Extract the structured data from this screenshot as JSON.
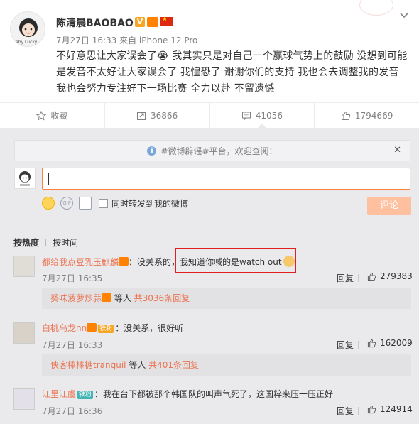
{
  "post": {
    "author": "陈清晨BAOBAO",
    "meta": "7月27日 16:33 来自 iPhone 12 Pro",
    "text": "不好意思让大家误会了😭 我其实只是对自己一个赢球气势上的鼓励 没想到可能是发音不太好让大家误会了 我惶恐了 谢谢你们的支持 我也会去调整我的发音 我也会努力专注好下一场比赛 全力以赴 不留遗憾",
    "avatar_caption": "Baby Lucky"
  },
  "actions": {
    "favorite": "收藏",
    "repost": "36866",
    "comment": "41056",
    "like": "1794669"
  },
  "notice": {
    "text": "#微博辟谣#平台，欢迎查阅！"
  },
  "composer": {
    "repost_checkbox_label": "同时转发到我的微博",
    "submit_label": "评论",
    "gif_label": "GIF"
  },
  "sort": {
    "hot": "按热度",
    "time": "按时间"
  },
  "comments": [
    {
      "name": "都给我点豆乳玉麒麟",
      "text_before": "：没关系的，",
      "text_highlight": "我知道你喊的是watch out",
      "time": "7月27日 16:35",
      "reply": "回复",
      "likes": "279383",
      "sub_name": "葵味菠萝炒蒜",
      "sub_mid": " 等人 ",
      "sub_count": "共3036条回复"
    },
    {
      "name": "白桃乌龙nn",
      "badge": "铁粉",
      "text_before": "：没关系，很好听",
      "time": "7月27日 16:33",
      "reply": "回复",
      "likes": "162009",
      "sub_name": "侠客棒棒糖tranquil",
      "sub_mid": " 等人 ",
      "sub_count": "共401条回复"
    },
    {
      "name": "江里江虞",
      "badge": "铁粉",
      "text_before": "：我在台下都被那个韩国队的叫声气死了，这国粹来压一压正好",
      "time": "7月27日 16:36",
      "reply": "回复",
      "likes": "124914"
    }
  ],
  "colors": {
    "accent": "#eb7350",
    "submit_disabled": "#ffc09f",
    "highlight": "#e02020",
    "badge_teal": "#42b4b4"
  }
}
